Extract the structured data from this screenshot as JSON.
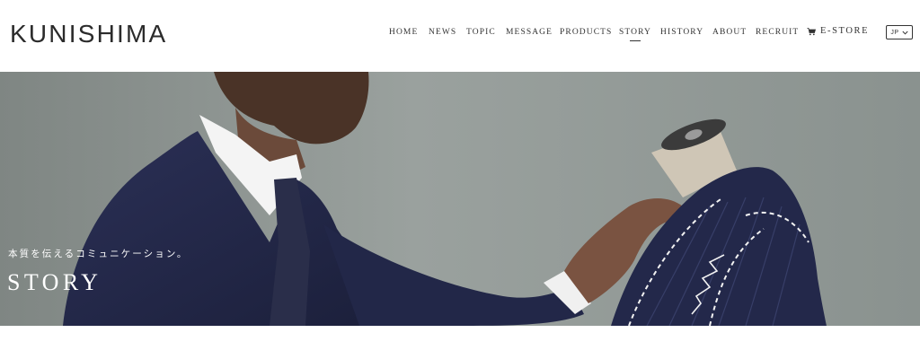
{
  "header": {
    "logo": "KUNISHIMA",
    "nav": [
      {
        "label": "HOME"
      },
      {
        "label": "NEWS"
      },
      {
        "label": "TOPIC"
      },
      {
        "label": "MESSAGE"
      },
      {
        "label": "PRODUCTS"
      },
      {
        "label": "STORY",
        "active": true
      },
      {
        "label": "HISTORY"
      },
      {
        "label": "ABOUT"
      },
      {
        "label": "RECRUIT"
      }
    ],
    "estore": {
      "label": "E-STORE",
      "icon": "cart-icon"
    },
    "language": {
      "label": "JP",
      "icon": "chevron-down-icon"
    }
  },
  "hero": {
    "subtitle": "本質を伝えるコミュニケーション。",
    "title": "STORY"
  },
  "colors": {
    "text": "#333333",
    "hero_background": "#8f9894",
    "suit_navy": "#23284a",
    "hero_text": "#ffffff"
  }
}
